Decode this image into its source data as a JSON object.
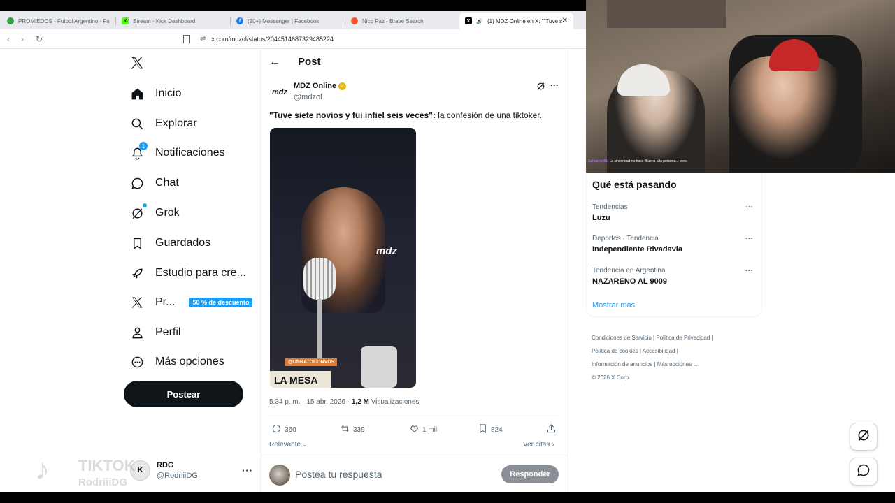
{
  "browser": {
    "tabs": [
      {
        "label": "PROMIEDOS - Futbol Argentino - Fu",
        "icon": "promiedos-favicon",
        "color": "#2f9e44"
      },
      {
        "label": "Stream - Kick Dashboard",
        "icon": "kick-favicon",
        "color": "#53fc18"
      },
      {
        "label": "(20+) Messenger | Facebook",
        "icon": "facebook-favicon",
        "color": "#1877f2"
      },
      {
        "label": "Nico Paz - Brave Search",
        "icon": "brave-favicon",
        "color": "#fb542b"
      },
      {
        "label": "(1) MDZ Online en X: \"\"Tuve s",
        "icon": "x-favicon",
        "color": "#000000"
      }
    ],
    "url": "x.com/mdzol/status/2044514687329485224"
  },
  "sidebar": {
    "items": [
      {
        "label": "Inicio",
        "icon": "home-icon"
      },
      {
        "label": "Explorar",
        "icon": "search-icon"
      },
      {
        "label": "Notificaciones",
        "icon": "bell-icon",
        "badge": "1"
      },
      {
        "label": "Chat",
        "icon": "chat-icon"
      },
      {
        "label": "Grok",
        "icon": "grok-icon"
      },
      {
        "label": "Guardados",
        "icon": "bookmark-icon"
      },
      {
        "label": "Estudio para cre...",
        "icon": "rocket-icon"
      },
      {
        "label": "Pr...",
        "icon": "x-logo-icon",
        "promo": "50 % de descuento"
      },
      {
        "label": "Perfil",
        "icon": "person-icon"
      },
      {
        "label": "Más opciones",
        "icon": "more-circle-icon"
      }
    ],
    "post_button": "Postear",
    "account": {
      "name": "RDG",
      "handle": "@RodriiiDG"
    }
  },
  "post": {
    "header_title": "Post",
    "author": {
      "name": "MDZ Online",
      "handle": "@mdzol",
      "avatar_text": "mdz"
    },
    "text_bold": "\"Tuve siete novios y fui infiel seis veces\":",
    "text_rest": " la confesión de una tiktoker.",
    "media": {
      "watermark": "mdz",
      "banner": "LA MESA",
      "tag": "@UNRATOCONVOS"
    },
    "time": "5:34 p. m. · 15 abr. 2026 · ",
    "views_count": "1,2 M",
    "views_label": " Visualizaciones",
    "stats": {
      "replies": "360",
      "reposts": "339",
      "likes": "1 mil",
      "bookmarks": "824"
    },
    "sort_label": "Relevante",
    "quotes_label": "Ver citas",
    "reply_placeholder": "Postea tu respuesta",
    "reply_button": "Responder"
  },
  "trends": {
    "title": "Qué está pasando",
    "items": [
      {
        "category": "Tendencias",
        "name": "Luzu"
      },
      {
        "category": "Deportes · Tendencia",
        "name": "Independiente Rivadavia"
      },
      {
        "category": "Tendencia en Argentina",
        "name": "NAZARENO AL 9009"
      }
    ],
    "show_more": "Mostrar más"
  },
  "footer": {
    "links": [
      "Condiciones de Servicio",
      "Política de Privacidad",
      "Política de cookies",
      "Accesibilidad",
      "Información de anuncios",
      "Más opciones ..."
    ],
    "copyright": "© 2026 X Corp."
  },
  "overlay": {
    "tiktok_label": "TIKTOK",
    "tiktok_user": "RodriiiDG",
    "chat_user": "SalvadoriiG",
    "chat_message": ": La sinceridad no hace Bluena a la persona... creo."
  }
}
